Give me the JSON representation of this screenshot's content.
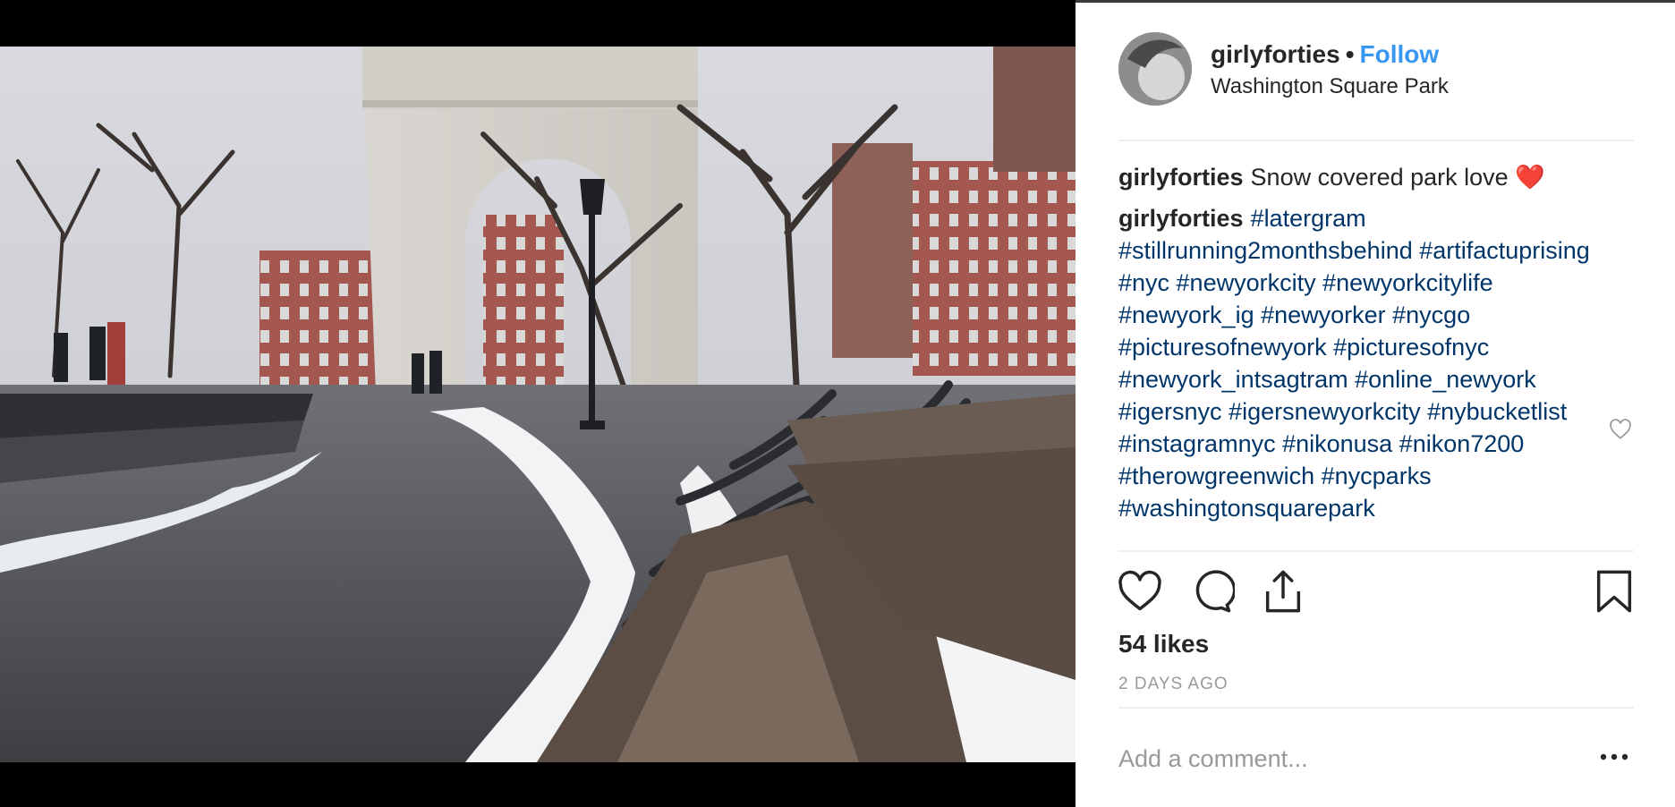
{
  "post": {
    "username": "girlyforties",
    "separator": "•",
    "follow_label": "Follow",
    "location": "Washington Square Park",
    "comments": [
      {
        "author": "girlyforties",
        "text": "Snow covered park love",
        "emoji": "❤️"
      },
      {
        "author": "girlyforties",
        "tags": "#latergram #stillrunning2monthsbehind #artifactuprising #nyc #newyorkcity #newyorkcitylife #newyork_ig #newyorker #nycgo #picturesofnewyork #picturesofnyc #newyork_intsagtram #online_newyork #igersnyc #igersnewyorkcity #nybucketlist #instagramnyc #nikonusa #nikon7200 #therowgreenwich #nycparks #washingtonsquarepark"
      }
    ],
    "likes": "54 likes",
    "age": "2 DAYS AGO",
    "comment_placeholder": "Add a comment...",
    "icons": {
      "like": "heart-outline-icon",
      "comment": "speech-bubble-icon",
      "share": "share-upload-icon",
      "save": "bookmark-icon",
      "more": "ellipsis-icon",
      "comment_like": "small-heart-icon"
    },
    "colors": {
      "accent": "#3897f0",
      "hashtag": "#003569",
      "muted": "#999999"
    }
  }
}
